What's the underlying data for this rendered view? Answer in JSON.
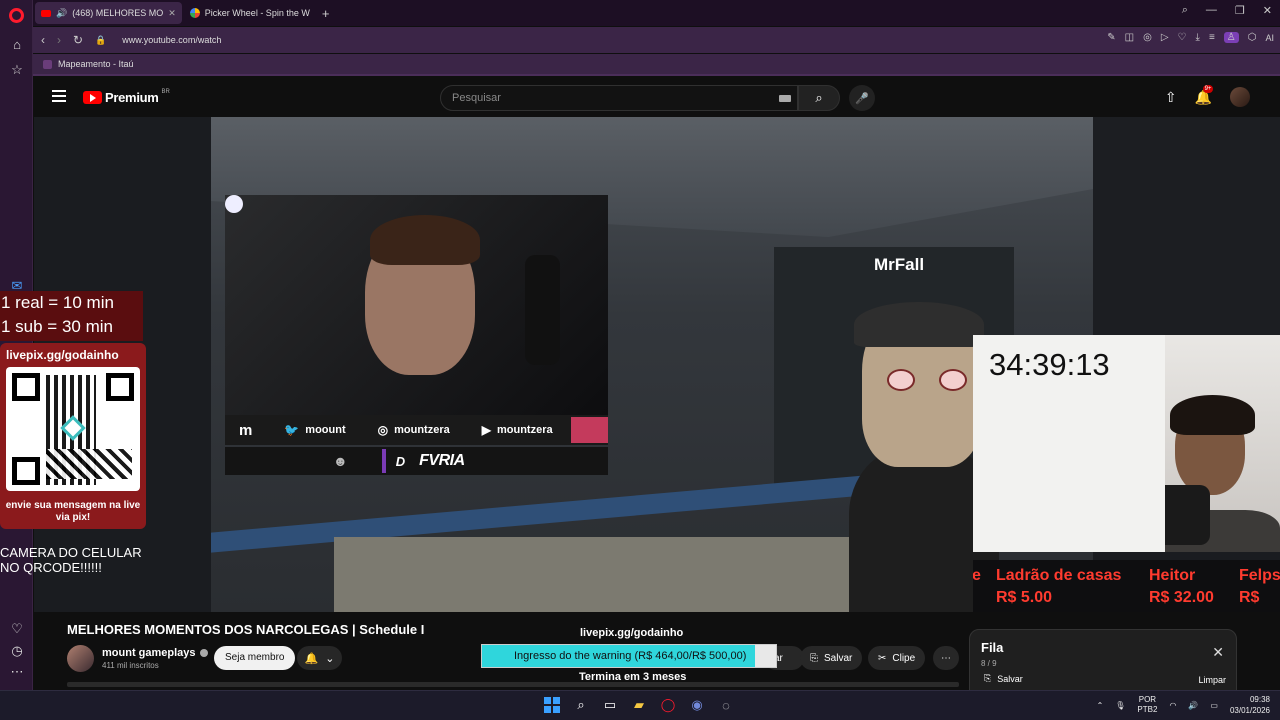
{
  "browser": {
    "tabs": [
      {
        "label": "(468) MELHORES MO",
        "active": true
      },
      {
        "label": "Picker Wheel - Spin the W",
        "active": false
      }
    ],
    "url": "www.youtube.com/watch",
    "bookmark": "Mapeamento - Itaú",
    "ai_label": "AI"
  },
  "youtube": {
    "logo_text": "Premium",
    "region": "BR",
    "search_placeholder": "Pesquisar",
    "notifications_badge": "9+"
  },
  "video": {
    "character_name": "MrFall",
    "socials": {
      "kick": "m",
      "twitter": "moount",
      "instagram": "mountzera",
      "youtube": "mountzera"
    },
    "team_letter": "D",
    "team_name": "FVRIA",
    "pix": {
      "rate_line1": "1 real = 10 min",
      "rate_line2": "1 sub = 30 min",
      "url": "livepix.gg/godainho",
      "message": "envie sua mensagem na live via pix!",
      "camera_note_line1": "CAMERA DO CELULAR",
      "camera_note_line2": "NO QRCODE!!!!!!"
    },
    "timer": "34:39:13",
    "ticker": [
      {
        "name": "e",
        "amount": ""
      },
      {
        "name": "Ladrão de casas",
        "amount": "R$ 5.00"
      },
      {
        "name": "Heitor",
        "amount": "R$ 32.00"
      },
      {
        "name": "Felps",
        "amount": "R$ 10"
      }
    ],
    "donation": {
      "url": "livepix.gg/godainho",
      "goal_text": "Ingresso do the warning (R$ 464,00/R$ 500,00)",
      "progress": 0.928,
      "ends": "Termina em 3 meses"
    }
  },
  "below": {
    "title": "MELHORES MOMENTOS DOS NARCOLEGAS | Schedule I",
    "channel": "mount gameplays",
    "subscribers": "411 mil inscritos",
    "member_button": "Seja membro",
    "share_fragment": "ar",
    "save_button": "Salvar",
    "clip_button": "Clipe"
  },
  "queue": {
    "title": "Fila",
    "count": "8 / 9",
    "save": "Salvar",
    "clear": "Limpar"
  },
  "taskbar": {
    "language": "POR",
    "layout": "PTB2",
    "time": "09:38",
    "date": "03/01/2026"
  }
}
